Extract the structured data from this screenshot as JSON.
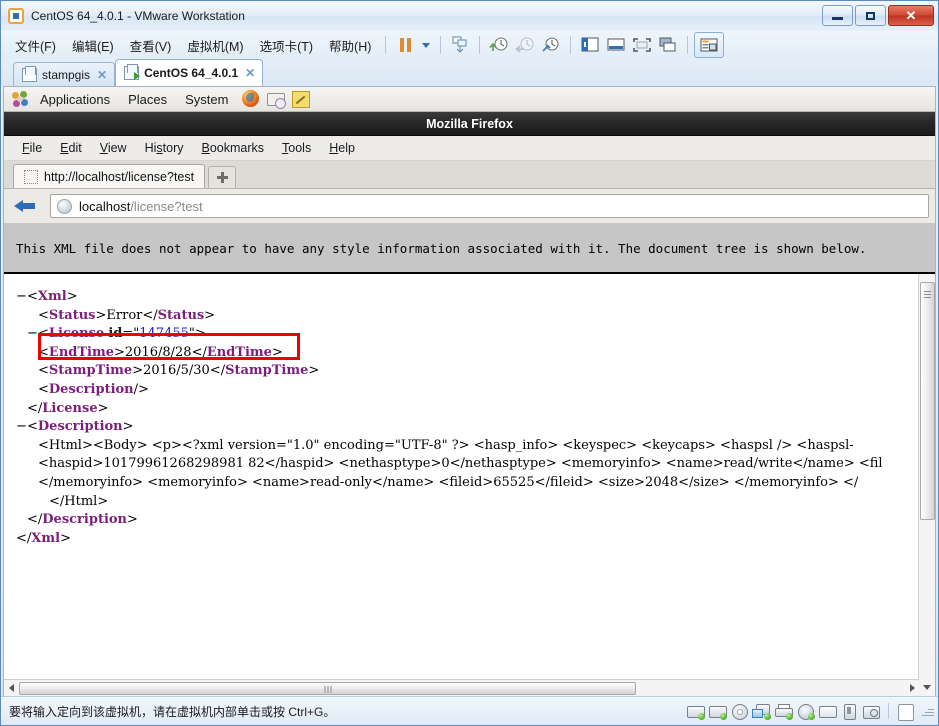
{
  "vmware": {
    "title": "CentOS 64_4.0.1 - VMware Workstation",
    "app_icon": "vmware-icon",
    "window_controls": {
      "minimize": "minimize-button",
      "restore": "restore-button",
      "close": "✕"
    },
    "menu": [
      {
        "label": "文件(F)",
        "name": "menu-file"
      },
      {
        "label": "编辑(E)",
        "name": "menu-edit"
      },
      {
        "label": "查看(V)",
        "name": "menu-view"
      },
      {
        "label": "虚拟机(M)",
        "name": "menu-vm"
      },
      {
        "label": "选项卡(T)",
        "name": "menu-tabs"
      },
      {
        "label": "帮助(H)",
        "name": "menu-help"
      }
    ],
    "toolbar": {
      "pause": "pause-icon",
      "dropdown": "chevron-down-icon",
      "snapshot_manager": "snapshot-manager-icon",
      "take_snapshot": "take-snapshot-icon",
      "revert_snapshot": "revert-snapshot-icon",
      "manage_snapshots": "manage-snapshots-icon",
      "show_library": "show-library-icon",
      "show_thumbnails": "show-thumbnail-bar-icon",
      "full_screen": "full-screen-icon",
      "unity": "unity-mode-icon",
      "console_view": "console-view-icon"
    },
    "tabs": [
      {
        "label": "stampgis",
        "active": false,
        "close": "✕"
      },
      {
        "label": "CentOS 64_4.0.1",
        "active": true,
        "close": "✕"
      }
    ],
    "status": {
      "hint": "要将输入定向到该虚拟机，请在虚拟机内部单击或按 Ctrl+G。",
      "devices": [
        "hard-disk-1-icon",
        "hard-disk-2-icon",
        "cd-dvd-icon",
        "network-adapter-icon",
        "printer-icon",
        "sound-card-icon",
        "display-icon",
        "usb-controller-icon",
        "camera-icon"
      ],
      "page_icon": "page-icon",
      "resize_grip": "resize-grip-icon"
    }
  },
  "gnome": {
    "foot_icon": "gnome-foot-icon",
    "menus": [
      "Applications",
      "Places",
      "System"
    ],
    "launchers": [
      "firefox-icon",
      "evolution-mail-icon",
      "notes-editor-icon"
    ]
  },
  "firefox": {
    "window_title": "Mozilla Firefox",
    "menu": [
      {
        "label": "File",
        "accel": "F"
      },
      {
        "label": "Edit",
        "accel": "E"
      },
      {
        "label": "View",
        "accel": "V"
      },
      {
        "label": "History",
        "accel": "s"
      },
      {
        "label": "Bookmarks",
        "accel": "B"
      },
      {
        "label": "Tools",
        "accel": "T"
      },
      {
        "label": "Help",
        "accel": "H"
      }
    ],
    "tab": {
      "title": "http://localhost/license?test",
      "favicon": "blank-favicon",
      "new_tab": "new-tab-plus-icon"
    },
    "navbar": {
      "back": "back-arrow-icon",
      "globe": "globe-icon",
      "url_host": "localhost",
      "url_path": "/license?test"
    },
    "notice": "This XML file does not appear to have any style information associated with it.  The document tree is shown below.",
    "scroll": {
      "v_up": "scroll-thumb-grip",
      "v_down": "scroll-down-arrow",
      "h_left": "scroll-left-arrow",
      "h_right": "scroll-right-arrow"
    }
  },
  "xml": {
    "highlight_color": "#ee0000",
    "lines": [
      {
        "indent": 0,
        "twisty": "−",
        "content": "open_xml"
      },
      {
        "indent": 1,
        "twisty": "",
        "content": "status"
      },
      {
        "indent": 1,
        "twisty": "−",
        "content": "open_license"
      },
      {
        "indent": 2,
        "twisty": "",
        "content": "endtime",
        "highlighted": true
      },
      {
        "indent": 2,
        "twisty": "",
        "content": "stamptime"
      },
      {
        "indent": 2,
        "twisty": "",
        "content": "description_empty"
      },
      {
        "indent": 1,
        "twisty": "",
        "content": "close_license"
      },
      {
        "indent": 0,
        "twisty": "−",
        "content": "open_description"
      },
      {
        "indent": 2,
        "twisty": "",
        "content": "desc_line_1"
      },
      {
        "indent": 2,
        "twisty": "",
        "content": "desc_line_2"
      },
      {
        "indent": 2,
        "twisty": "",
        "content": "desc_line_3"
      },
      {
        "indent": 2,
        "twisty": "",
        "content": "close_html"
      },
      {
        "indent": 1,
        "twisty": "",
        "content": "close_description"
      },
      {
        "indent": 0,
        "twisty": "",
        "content": "close_xml"
      }
    ],
    "tokens": {
      "root_tag": "Xml",
      "status_tag": "Status",
      "status_value": "Error",
      "license_tag": "License",
      "license_attr_name": "id",
      "license_attr_value": "147455",
      "endtime_tag": "EndTime",
      "endtime_value": "2016/8/28",
      "stamptime_tag": "StampTime",
      "stamptime_value": "2016/5/30",
      "description_tag": "Description",
      "html_open": "<Html><Body> <p><?xml version=\"1.0\" encoding=\"UTF-8\" ?> <hasp_info> <keyspec> <keycaps> <haspsl /> <haspsl-",
      "haspid_line": "<haspid>10179961268298981 82</haspid> <nethasptype>0</nethasptype> <memoryinfo> <name>read/write</name> <fil",
      "memoryinfo_line": "</memoryinfo> <memoryinfo> <name>read-only</name> <fileid>65525</fileid> <size>2048</size> </memoryinfo> </",
      "html_close": "</Html>",
      "haspid_value": "10179961268298981 82",
      "nethasptype_value": "0",
      "fileid_value": "65525",
      "size_value": "2048"
    }
  }
}
